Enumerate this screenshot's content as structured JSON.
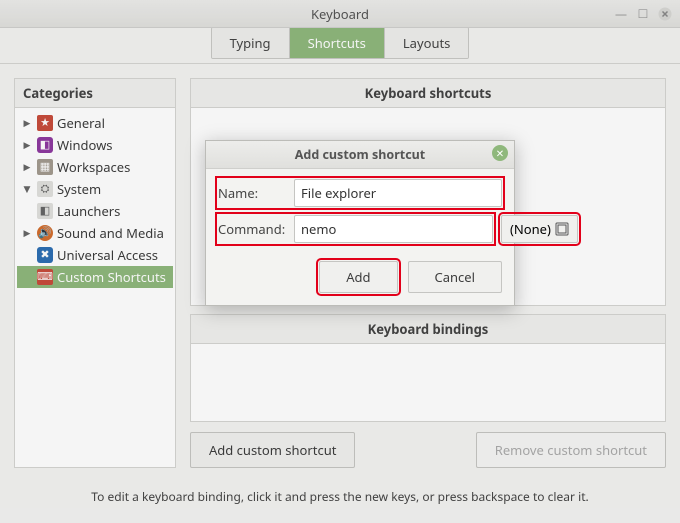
{
  "window": {
    "title": "Keyboard"
  },
  "tabs": {
    "typing": "Typing",
    "shortcuts": "Shortcuts",
    "layouts": "Layouts"
  },
  "sidebar": {
    "header": "Categories",
    "items": [
      {
        "label": "General"
      },
      {
        "label": "Windows"
      },
      {
        "label": "Workspaces"
      },
      {
        "label": "System"
      },
      {
        "label": "Launchers"
      },
      {
        "label": "Sound and Media"
      },
      {
        "label": "Universal Access"
      },
      {
        "label": "Custom Shortcuts"
      }
    ]
  },
  "panels": {
    "shortcuts_header": "Keyboard shortcuts",
    "bindings_header": "Keyboard bindings"
  },
  "buttons": {
    "add_custom": "Add custom shortcut",
    "remove_custom": "Remove custom shortcut"
  },
  "hint": "To edit a keyboard binding, click it and press the new keys, or press backspace to clear it.",
  "dialog": {
    "title": "Add custom shortcut",
    "name_label": "Name:",
    "name_value": "File explorer",
    "command_label": "Command:",
    "command_value": "nemo",
    "icon_none": "(None)",
    "add": "Add",
    "cancel": "Cancel"
  }
}
